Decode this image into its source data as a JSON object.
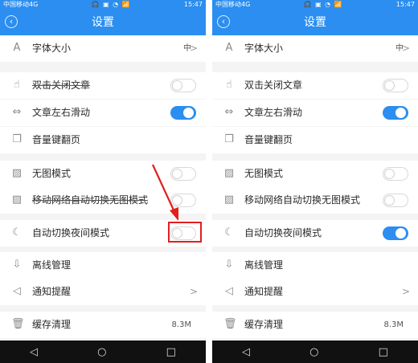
{
  "colors": {
    "accent": "#2b8ef0",
    "highlight": "#e21e1e"
  },
  "screens": [
    {
      "status": {
        "carrier": "中国移动4G",
        "icons": "🎧 ▣ ◔ 📶",
        "time": "15:47"
      },
      "title": "设置",
      "rows": [
        {
          "icon": "font-size-icon",
          "glyph": "A",
          "label": "字体大小",
          "value": "中",
          "chevron": ">",
          "control": "value"
        },
        {
          "icon": "hand-tap-icon",
          "glyph": "☝",
          "label": "双击关闭文章",
          "control": "toggle",
          "on": false
        },
        {
          "icon": "swipe-icon",
          "glyph": "⇔",
          "label": "文章左右滑动",
          "control": "toggle",
          "on": true
        },
        {
          "icon": "pages-icon",
          "glyph": "❐",
          "label": "音量键翻页",
          "control": "none"
        },
        {
          "icon": "image-icon",
          "glyph": "▨",
          "label": "无图模式",
          "control": "toggle",
          "on": false
        },
        {
          "icon": "image-network-icon",
          "glyph": "▨",
          "label": "移动网络自动切换无图模式",
          "control": "toggle",
          "on": false
        },
        {
          "icon": "moon-icon",
          "glyph": "☾",
          "label": "自动切换夜间模式",
          "control": "toggle",
          "on": false
        },
        {
          "icon": "download-icon",
          "glyph": "⇩",
          "label": "离线管理",
          "control": "none"
        },
        {
          "icon": "speaker-icon",
          "glyph": "◁",
          "label": "通知提醒",
          "chevron": ">",
          "control": "chevron"
        },
        {
          "icon": "trash-icon",
          "glyph": "🗑",
          "label": "缓存清理",
          "value": "8.3M",
          "control": "value"
        }
      ]
    },
    {
      "status": {
        "carrier": "中国移动4G",
        "icons": "🎧 ▣ ◔ 📶",
        "time": "15:47"
      },
      "title": "设置",
      "rows": [
        {
          "icon": "font-size-icon",
          "glyph": "A",
          "label": "字体大小",
          "value": "中",
          "chevron": ">",
          "control": "value"
        },
        {
          "icon": "hand-tap-icon",
          "glyph": "☝",
          "label": "双击关闭文章",
          "control": "toggle",
          "on": false
        },
        {
          "icon": "swipe-icon",
          "glyph": "⇔",
          "label": "文章左右滑动",
          "control": "toggle",
          "on": true
        },
        {
          "icon": "pages-icon",
          "glyph": "❐",
          "label": "音量键翻页",
          "control": "none"
        },
        {
          "icon": "image-icon",
          "glyph": "▨",
          "label": "无图模式",
          "control": "toggle",
          "on": false
        },
        {
          "icon": "image-network-icon",
          "glyph": "▨",
          "label": "移动网络自动切换无图模式",
          "control": "toggle",
          "on": false
        },
        {
          "icon": "moon-icon",
          "glyph": "☾",
          "label": "自动切换夜间模式",
          "control": "toggle",
          "on": true
        },
        {
          "icon": "download-icon",
          "glyph": "⇩",
          "label": "离线管理",
          "control": "none"
        },
        {
          "icon": "speaker-icon",
          "glyph": "◁",
          "label": "通知提醒",
          "chevron": ">",
          "control": "chevron"
        },
        {
          "icon": "trash-icon",
          "glyph": "🗑",
          "label": "缓存清理",
          "value": "8.3M",
          "control": "value"
        }
      ]
    }
  ],
  "navbar": {
    "back": "◁",
    "home": "○",
    "recent": "□"
  }
}
